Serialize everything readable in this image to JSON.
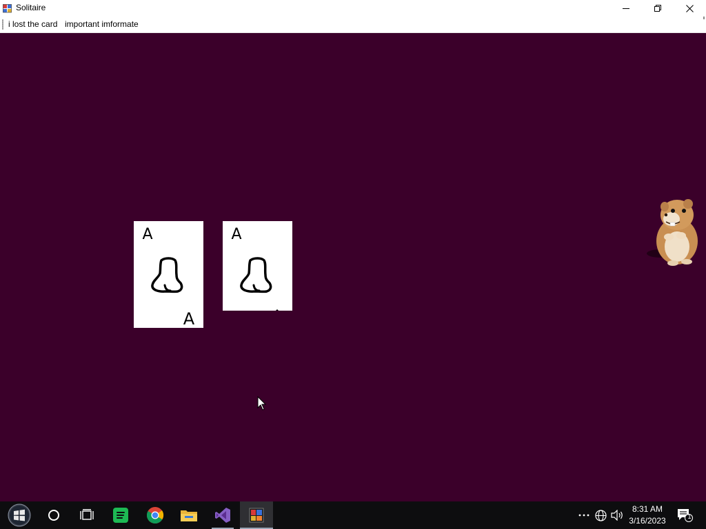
{
  "window": {
    "title": "Solitaire",
    "background_color": "#3b002a",
    "controls": {
      "minimize_icon": "minimize-icon",
      "maximize_icon": "restore-icon",
      "close_icon": "close-icon"
    }
  },
  "menu": {
    "items": [
      {
        "label": "i lost the card"
      },
      {
        "label": "important imformate"
      }
    ]
  },
  "cards": [
    {
      "rank_top": "A",
      "rank_bottom": "A",
      "suit_icon": "boot-icon"
    },
    {
      "rank_top": "A",
      "suit_icon": "boot-icon"
    }
  ],
  "mascot": {
    "icon": "hamster-image"
  },
  "taskbar": {
    "buttons": [
      {
        "name": "start",
        "icon": "windows-logo-icon"
      },
      {
        "name": "search",
        "icon": "cortana-circle-icon"
      },
      {
        "name": "task-view",
        "icon": "task-view-icon"
      },
      {
        "name": "spotify",
        "icon": "spotify-icon"
      },
      {
        "name": "chrome",
        "icon": "chrome-icon"
      },
      {
        "name": "file-explorer",
        "icon": "folder-icon"
      },
      {
        "name": "visual-studio",
        "icon": "visual-studio-icon"
      },
      {
        "name": "solitaire",
        "icon": "app-window-icon"
      }
    ],
    "tray": {
      "icons": [
        "overflow-icon",
        "network-globe-icon",
        "volume-icon",
        "notification-icon"
      ],
      "notification_count": "1"
    },
    "clock": {
      "time": "8:31 AM",
      "date": "3/16/2023"
    }
  }
}
